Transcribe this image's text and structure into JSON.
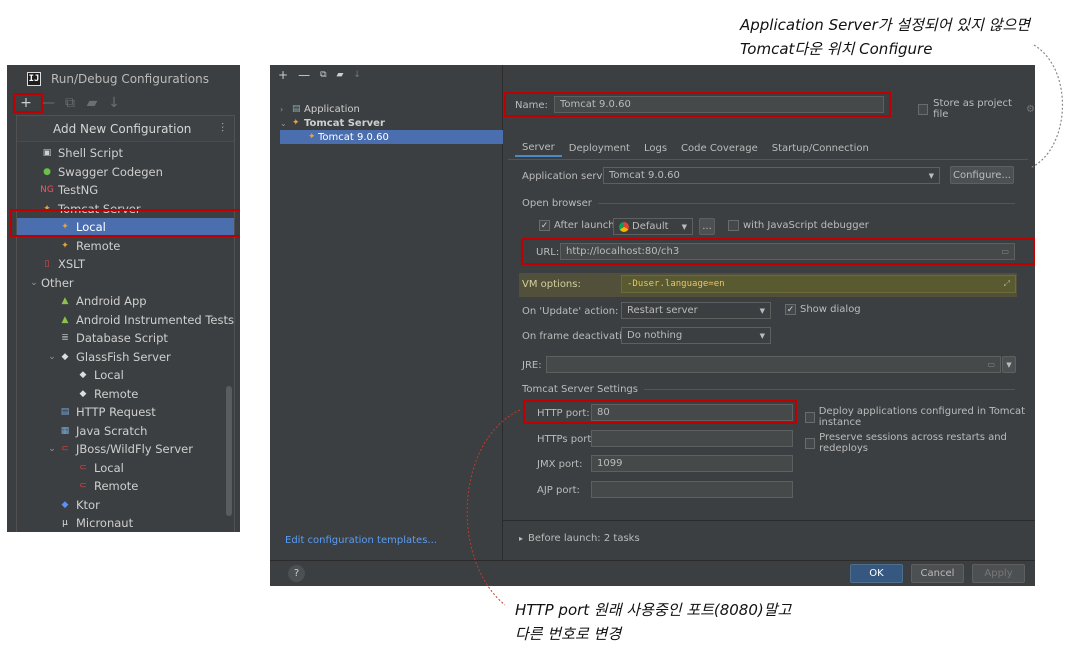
{
  "left_panel": {
    "title": "Run/Debug Configurations",
    "popup_header": "Add New Configuration",
    "items": [
      {
        "label": "Shell Script",
        "indent": 0,
        "icon": "shell-icon"
      },
      {
        "label": "Swagger Codegen",
        "indent": 0,
        "icon": "swagger-icon"
      },
      {
        "label": "TestNG",
        "indent": 0,
        "icon": "testng-icon"
      },
      {
        "label": "Tomcat Server",
        "indent": 0,
        "icon": "tomcat-icon",
        "expanded": true
      },
      {
        "label": "Local",
        "indent": 1,
        "icon": "tomcat-icon",
        "selected": true
      },
      {
        "label": "Remote",
        "indent": 1,
        "icon": "tomcat-icon"
      },
      {
        "label": "XSLT",
        "indent": 0,
        "icon": "xslt-icon"
      },
      {
        "label": "Other",
        "indent": 0,
        "icon": "",
        "expanded": true
      },
      {
        "label": "Android App",
        "indent": 1,
        "icon": "android-icon"
      },
      {
        "label": "Android Instrumented Tests",
        "indent": 1,
        "icon": "android-icon"
      },
      {
        "label": "Database Script",
        "indent": 1,
        "icon": "database-icon"
      },
      {
        "label": "GlassFish Server",
        "indent": 1,
        "icon": "glassfish-icon",
        "expanded": true
      },
      {
        "label": "Local",
        "indent": 2,
        "icon": "glassfish-icon"
      },
      {
        "label": "Remote",
        "indent": 2,
        "icon": "glassfish-icon"
      },
      {
        "label": "HTTP Request",
        "indent": 1,
        "icon": "http-icon"
      },
      {
        "label": "Java Scratch",
        "indent": 1,
        "icon": "java-icon"
      },
      {
        "label": "JBoss/WildFly Server",
        "indent": 1,
        "icon": "jboss-icon",
        "expanded": true
      },
      {
        "label": "Local",
        "indent": 2,
        "icon": "jboss-icon"
      },
      {
        "label": "Remote",
        "indent": 2,
        "icon": "jboss-icon"
      },
      {
        "label": "Ktor",
        "indent": 1,
        "icon": "ktor-icon"
      },
      {
        "label": "Micronaut",
        "indent": 1,
        "icon": "micronaut-icon"
      }
    ]
  },
  "main_dialog": {
    "tree": {
      "application": "Application",
      "tomcat_server": "Tomcat Server",
      "tomcat_config": "Tomcat 9.0.60"
    },
    "edit_templates_link": "Edit configuration templates...",
    "name_label": "Name:",
    "name_value": "Tomcat 9.0.60",
    "store_label": "Store as project file",
    "tabs": [
      "Server",
      "Deployment",
      "Logs",
      "Code Coverage",
      "Startup/Connection"
    ],
    "app_server_label": "Application server:",
    "app_server_value": "Tomcat 9.0.60",
    "configure_button": "Configure...",
    "open_browser_title": "Open browser",
    "after_launch_label": "After launch",
    "browser_value": "Default",
    "browse_button": "...",
    "js_debugger_label": "with JavaScript debugger",
    "url_label": "URL:",
    "url_value": "http://localhost:80/ch3",
    "vm_options_label": "VM options:",
    "vm_options_value": "-Duser.language=en",
    "on_update_label": "On 'Update' action:",
    "on_update_value": "Restart server",
    "show_dialog_label": "Show dialog",
    "on_frame_label": "On frame deactivation:",
    "on_frame_value": "Do nothing",
    "jre_label": "JRE:",
    "tomcat_settings_title": "Tomcat Server Settings",
    "http_port_label": "HTTP port:",
    "http_port_value": "80",
    "https_port_label": "HTTPs port:",
    "https_port_value": "",
    "jmx_port_label": "JMX port:",
    "jmx_port_value": "1099",
    "ajp_port_label": "AJP port:",
    "ajp_port_value": "",
    "deploy_label": "Deploy applications configured in Tomcat instance",
    "preserve_label": "Preserve sessions across restarts and redeploys",
    "before_launch_label": "Before launch: 2 tasks",
    "ok_button": "OK",
    "cancel_button": "Cancel",
    "apply_button": "Apply",
    "help_button": "?"
  },
  "annotations": {
    "top_line1": "Application Server가 설정되어 있지 않으면",
    "top_line2": "Tomcat다운 위치 Configure",
    "bottom_line1": "HTTP port 원래 사용중인 포트(8080)말고",
    "bottom_line2": "다른 번호로 변경"
  },
  "colors": {
    "highlight_red": "#c00000",
    "ide_bg": "#3c3f41",
    "selection_blue": "#4b6eaf",
    "vm_options_bg": "#52503a"
  }
}
